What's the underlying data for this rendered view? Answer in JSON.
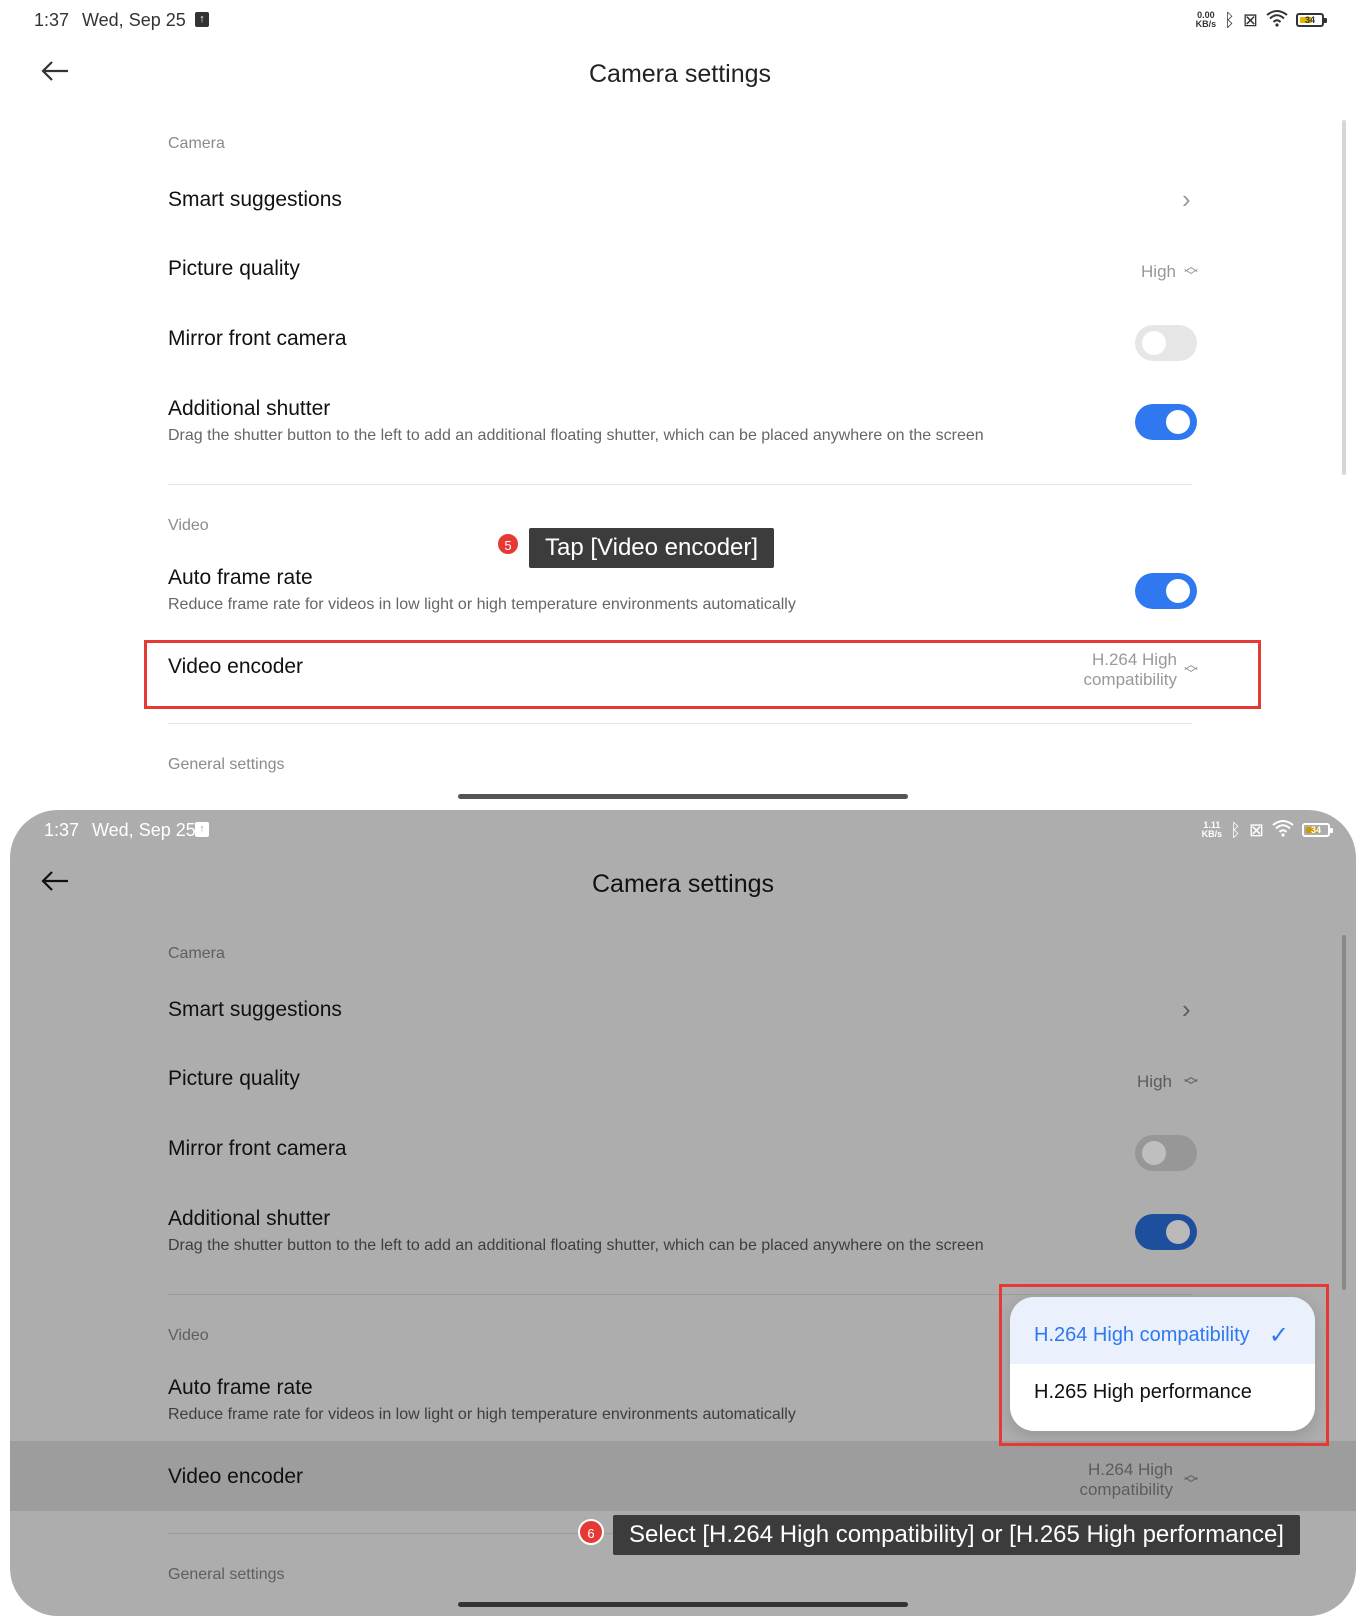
{
  "panels": [
    {
      "status": {
        "time": "1:37",
        "date": "Wed, Sep 25",
        "net_speed_top": "0.00",
        "net_speed_unit": "KB/s",
        "battery": "34"
      },
      "title": "Camera settings",
      "camera_section": "Camera",
      "smart_suggestions": "Smart suggestions",
      "picture_quality": "Picture quality",
      "picture_quality_value": "High",
      "mirror_front_camera": "Mirror front camera",
      "additional_shutter": "Additional shutter",
      "additional_shutter_desc": "Drag the shutter button to the left to add an additional floating shutter, which can be placed anywhere on the screen",
      "video_section": "Video",
      "auto_frame_rate": "Auto frame rate",
      "auto_frame_rate_desc": "Reduce frame rate for videos in low light or high temperature environments automatically",
      "video_encoder": "Video encoder",
      "video_encoder_value_1": "H.264 High",
      "video_encoder_value_2": "compatibility",
      "general_section": "General settings",
      "toggles": {
        "mirror_front_camera": false,
        "additional_shutter": true,
        "auto_frame_rate": true
      }
    },
    {
      "status": {
        "time": "1:37",
        "date": "Wed, Sep 25",
        "net_speed_top": "1.11",
        "net_speed_unit": "KB/s",
        "battery": "34"
      },
      "title": "Camera settings",
      "camera_section": "Camera",
      "smart_suggestions": "Smart suggestions",
      "picture_quality": "Picture quality",
      "picture_quality_value": "High",
      "mirror_front_camera": "Mirror front camera",
      "additional_shutter": "Additional shutter",
      "additional_shutter_desc": "Drag the shutter button to the left to add an additional floating shutter, which can be placed anywhere on the screen",
      "video_section": "Video",
      "auto_frame_rate": "Auto frame rate",
      "auto_frame_rate_desc": "Reduce frame rate for videos in low light or high temperature environments automatically",
      "video_encoder": "Video encoder",
      "video_encoder_value_1": "H.264 High",
      "video_encoder_value_2": "compatibility",
      "general_section": "General settings",
      "toggles": {
        "mirror_front_camera": false,
        "additional_shutter": true,
        "auto_frame_rate": true
      }
    }
  ],
  "annotations": {
    "step5_number": "5",
    "step5_text": "Tap [Video encoder]",
    "step6_number": "6",
    "step6_text": "Select [H.264 High compatibility] or [H.265 High performance]"
  },
  "encoder_menu": {
    "options": [
      "H.264 High compatibility",
      "H.265 High performance"
    ],
    "selected_index": 0
  },
  "colors": {
    "accent": "#2f78f0",
    "highlight_box": "#e53935"
  }
}
